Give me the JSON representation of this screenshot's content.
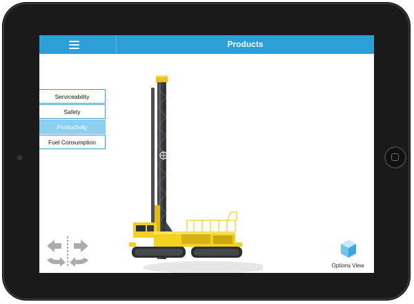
{
  "header": {
    "title": "Products"
  },
  "feature_list": [
    {
      "label": "Serviceability",
      "active": false
    },
    {
      "label": "Safety",
      "active": false
    },
    {
      "label": "Productivity",
      "active": true
    },
    {
      "label": "Fuel Consumption",
      "active": false
    }
  ],
  "options": {
    "label": "Options View"
  },
  "colors": {
    "accent": "#2d9fd6",
    "active_item": "#8ccfee",
    "rig_yellow": "#f3d21f",
    "device_frame": "#1a1a1b"
  },
  "icons": {
    "menu": "hamburger-menu-icon",
    "rotate": "rotate-arrows-icon",
    "options": "cube-icon",
    "home": "home-button"
  }
}
